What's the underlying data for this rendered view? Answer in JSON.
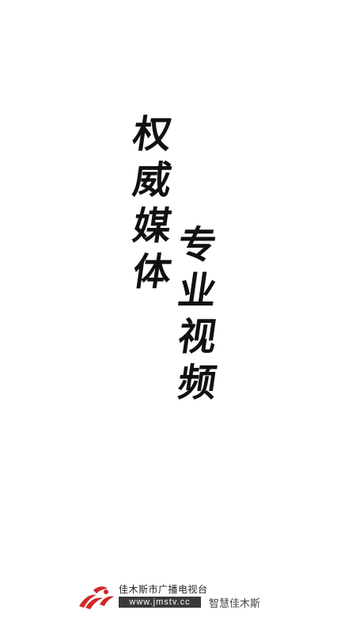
{
  "splash": {
    "line1": [
      "权",
      "威",
      "媒",
      "体"
    ],
    "line2": [
      "专",
      "业",
      "视",
      "频"
    ]
  },
  "footer": {
    "logo_icon": "jms-tv-logo",
    "station_name": "佳木斯市广播电视台",
    "url": "www.jmstv.cc",
    "slogan": "智慧佳木斯",
    "brand_color": "#d0282a"
  }
}
